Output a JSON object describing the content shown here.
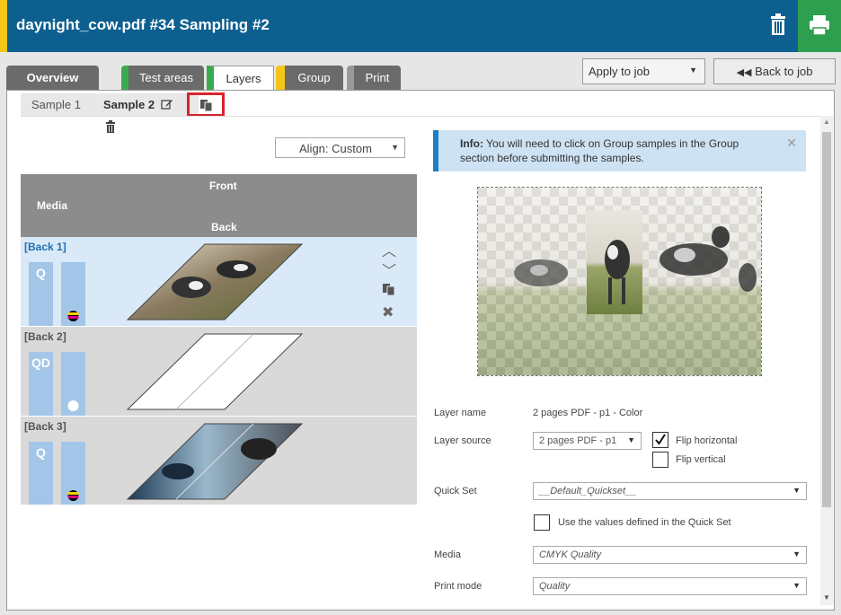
{
  "header": {
    "title": "daynight_cow.pdf #34 Sampling #2",
    "accent_color": "#0d5f8f",
    "trash_icon": "trash-icon",
    "print_icon": "printer-icon"
  },
  "tabs": [
    {
      "label": "Overview"
    },
    {
      "label": "Test areas"
    },
    {
      "label": "Layers"
    },
    {
      "label": "Group"
    },
    {
      "label": "Print"
    }
  ],
  "apply": {
    "label": "Apply to job"
  },
  "back": {
    "label": "Back to job"
  },
  "subtabs": {
    "sample1": "Sample 1",
    "sample2": "Sample 2"
  },
  "align": {
    "label": "Align: Custom"
  },
  "grid": {
    "front": "Front",
    "media": "Media",
    "back": "Back",
    "rows": [
      {
        "label": "[Back 1]",
        "badge": "Q"
      },
      {
        "label": "[Back 2]",
        "badge": "QD"
      },
      {
        "label": "[Back 3]",
        "badge": "Q"
      }
    ]
  },
  "info": {
    "bold": "Info:",
    "text": "You will need to click on Group samples in the Group section before submitting the samples."
  },
  "form": {
    "layer_name_label": "Layer name",
    "layer_name_value": "2 pages PDF - p1 - Color",
    "layer_source_label": "Layer source",
    "layer_source_value": "2 pages PDF - p1",
    "flip_horizontal": "Flip horizontal",
    "flip_vertical": "Flip vertical",
    "quick_set_label": "Quick Set",
    "quick_set_value": "__Default_Quickset__",
    "use_values": "Use the values defined in the Quick Set",
    "media_label": "Media",
    "media_value": "CMYK Quality",
    "print_mode_label": "Print mode",
    "print_mode_value": "Quality"
  }
}
